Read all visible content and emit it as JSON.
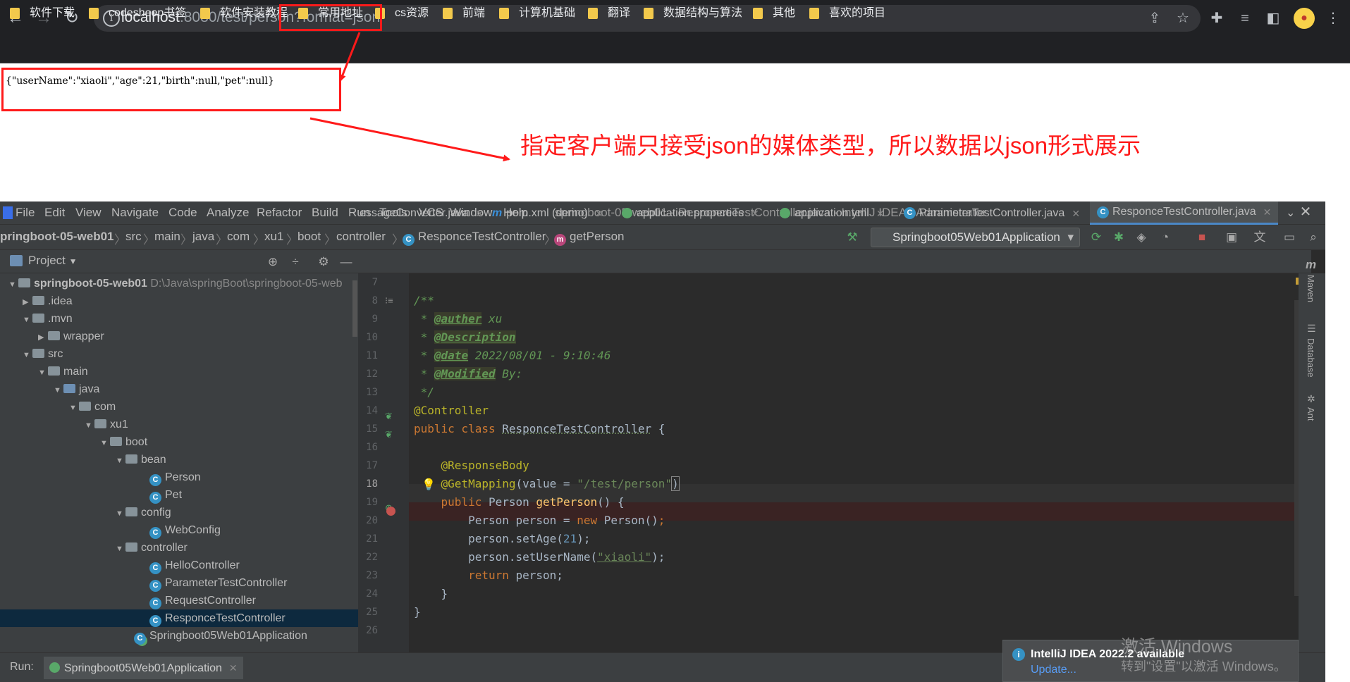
{
  "browser": {
    "url_host": "localhost",
    "url_rest": ":8080/test/person?format=json",
    "bookmarks": [
      "软件下载",
      "codesheep书签",
      "软件安装教程",
      "常用地址",
      "cs资源",
      "前端",
      "计算机基础",
      "翻译",
      "数据结构与算法",
      "其他",
      "喜欢的项目"
    ]
  },
  "page": {
    "json_response": "{\"userName\":\"xiaoli\",\"age\":21,\"birth\":null,\"pet\":null}",
    "annotation": "指定客户端只接受json的媒体类型，所以数据以json形式展示"
  },
  "ide": {
    "menu": [
      "File",
      "Edit",
      "View",
      "Navigate",
      "Code",
      "Analyze",
      "Refactor",
      "Build",
      "Run",
      "Tools",
      "VCS",
      "Window",
      "Help"
    ],
    "title": "springboot-05-web01 - ResponceTestController.java - IntelliJ IDEA - Administrator",
    "breadcrumbs": [
      "pringboot-05-web01",
      "src",
      "main",
      "java",
      "com",
      "xu1",
      "boot",
      "controller",
      "ResponceTestController",
      "getPerson"
    ],
    "run_config": "Springboot05Web01Application",
    "project_label": "Project",
    "tabs": [
      "essageConverter.java",
      "pom.xml (demo)",
      "application.properties",
      "application.yml",
      "ParameterTestController.java",
      "ResponceTestController.java"
    ],
    "tree": [
      {
        "label": "springboot-05-web01",
        "hint": "D:\\Java\\springBoot\\springboot-05-web"
      },
      {
        "label": ".idea"
      },
      {
        "label": ".mvn"
      },
      {
        "label": "wrapper"
      },
      {
        "label": "src"
      },
      {
        "label": "main"
      },
      {
        "label": "java"
      },
      {
        "label": "com"
      },
      {
        "label": "xu1"
      },
      {
        "label": "boot"
      },
      {
        "label": "bean"
      },
      {
        "label": "Person"
      },
      {
        "label": "Pet"
      },
      {
        "label": "config"
      },
      {
        "label": "WebConfig"
      },
      {
        "label": "controller"
      },
      {
        "label": "HelloController"
      },
      {
        "label": "ParameterTestController"
      },
      {
        "label": "RequestController"
      },
      {
        "label": "ResponceTestController"
      },
      {
        "label": "Springboot05Web01Application"
      }
    ],
    "line_numbers": [
      "7",
      "8",
      "9",
      "10",
      "11",
      "12",
      "13",
      "14",
      "15",
      "16",
      "17",
      "18",
      "19",
      "20",
      "21",
      "22",
      "23",
      "24",
      "25",
      "26"
    ],
    "code": {
      "l8": "/**",
      "l9_tag": "@auther",
      "l9_val": " xu",
      "l10_tag": "@Description",
      "l11_tag": "@date",
      "l11_val": " 2022/08/01 - 9:10:46",
      "l12_tag": "@Modified",
      "l12_val": " By:",
      "l13": " */",
      "l14": "@Controller",
      "l15_kw": "public class ",
      "l15_name": "ResponceTestController",
      "l15_end": " {",
      "l17": "@ResponseBody",
      "l18_ann": "@GetMapping",
      "l18_a": "(value = ",
      "l18_str": "\"/test/person\"",
      "l18_b": ")",
      "l19_kw": "public ",
      "l19_type": "Person ",
      "l19_fn": "getPerson",
      "l19_end": "() {",
      "l20_a": "Person person = ",
      "l20_kw": "new ",
      "l20_b": "Person()",
      "l20_c": ";",
      "l21_a": "person.setAge(",
      "l21_num": "21",
      "l21_b": ");",
      "l22_a": "person.setUserName(",
      "l22_str": "\"xiaoli\"",
      "l22_b": ");",
      "l23_kw": "return ",
      "l23_a": "person;",
      "l24": "}",
      "l25": "}"
    },
    "side_tools": [
      "Maven",
      "Database",
      "Ant"
    ],
    "run_label": "Run:",
    "run_app": "Springboot05Web01Application",
    "notification": {
      "title": "IntelliJ IDEA 2022.2 available",
      "link": "Update..."
    },
    "watermark": {
      "line1": "激活 Windows",
      "line2": "转到\"设置\"以激活 Windows。"
    }
  },
  "colors": {
    "annotation_red": "#ff1a1a",
    "ide_bg": "#2b2b2b",
    "browser_bg": "#202124"
  }
}
